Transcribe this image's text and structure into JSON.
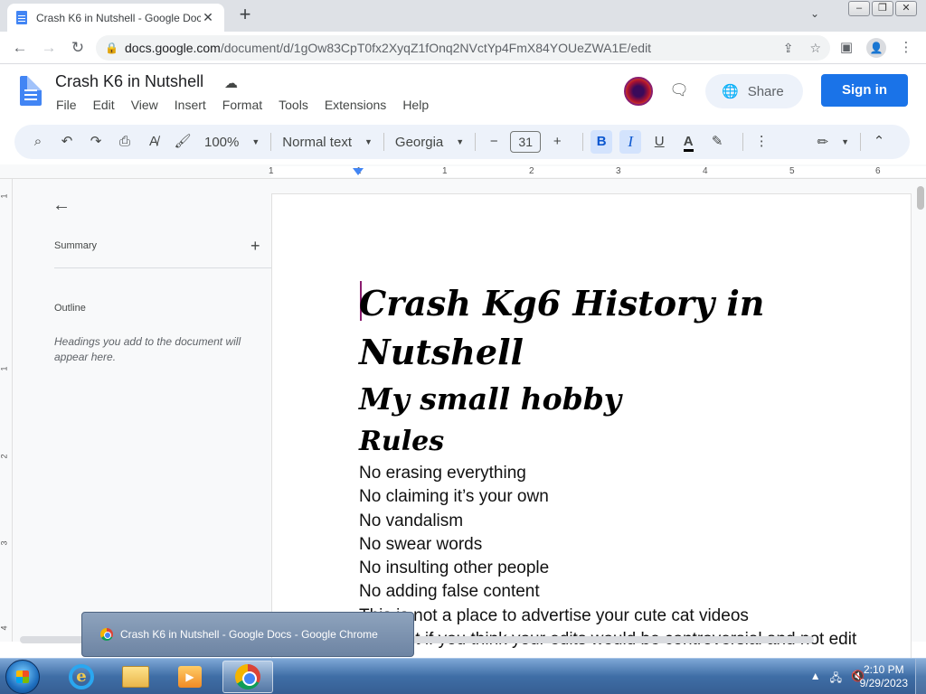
{
  "browser": {
    "tab_title": "Crash K6 in Nutshell - Google Docs",
    "url_domain": "docs.google.com",
    "url_path": "/document/d/1gOw83CpT0fx2XyqZ1fOnq2NVctYp4FmX84YOUeZWA1E/edit",
    "new_tab_glyph": "+",
    "tab_close_glyph": "✕",
    "tab_search_glyph": "⌄"
  },
  "docs": {
    "title": "Crash K6 in Nutshell",
    "menus": [
      "File",
      "Edit",
      "View",
      "Insert",
      "Format",
      "Tools",
      "Extensions",
      "Help"
    ],
    "share_label": "Share",
    "signin_label": "Sign in"
  },
  "toolbar": {
    "zoom": "100%",
    "style": "Normal text",
    "font": "Georgia",
    "font_size": "31",
    "bold": "B",
    "italic": "I",
    "underline": "U",
    "text_color": "A"
  },
  "ruler": {
    "h_ticks": [
      "1",
      "1",
      "1",
      "2",
      "3",
      "4",
      "5",
      "6"
    ],
    "v_ticks": [
      "1",
      "1",
      "2",
      "3",
      "4"
    ]
  },
  "outline": {
    "summary_label": "Summary",
    "outline_label": "Outline",
    "hint": "Headings you add to the document will appear here."
  },
  "document": {
    "heading1": "Crash Kg6 History in Nutshell",
    "heading2": "My small hobby",
    "heading3": "Rules",
    "rules": [
      "No erasing everything",
      "No claiming it’s your own",
      "No vandalism",
      "No swear words",
      "No insulting other people",
      "No adding false content",
      "This is not a place to advertise your cute cat videos",
      "Ask first if you think your edits would be controversial and not edit"
    ]
  },
  "taskbar": {
    "preview_title": "Crash K6 in Nutshell - Google Docs - Google Chrome",
    "time": "2:10 PM",
    "date": "9/29/2023"
  },
  "colors": {
    "accent": "#1a73e8",
    "toolbar_bg": "#edf2fa",
    "taskbar": "#3f6ea6"
  }
}
